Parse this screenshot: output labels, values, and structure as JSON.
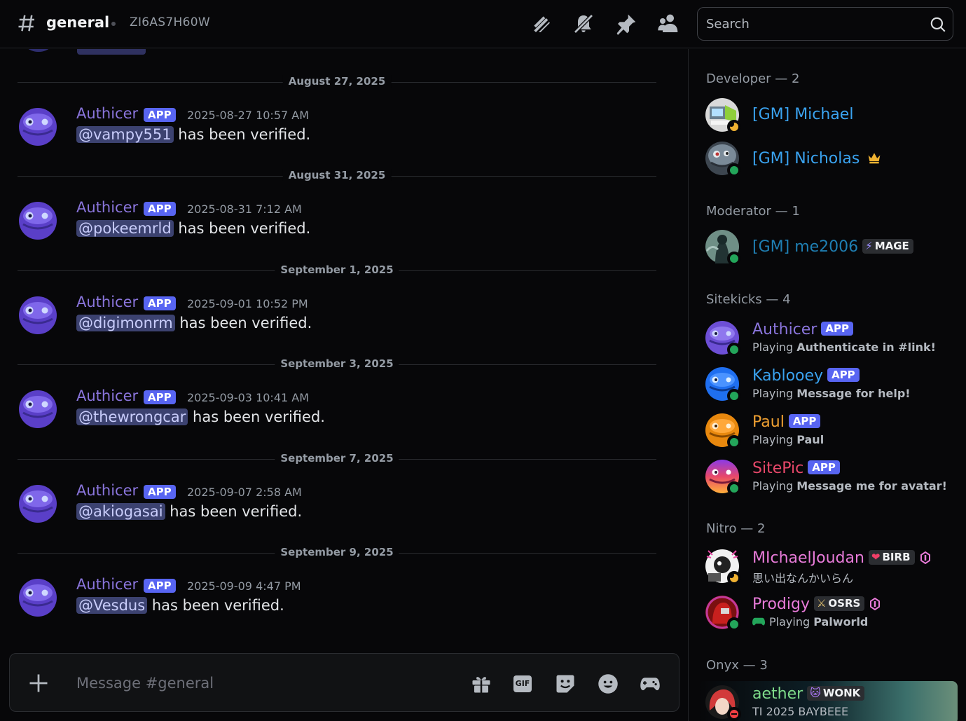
{
  "header": {
    "channel_name": "general",
    "channel_topic": "ZI6AS7H60W",
    "search_placeholder": "Search",
    "icons": [
      "threads-icon",
      "notifications-muted-icon",
      "pin-icon",
      "members-icon"
    ]
  },
  "chat": {
    "messages": [
      {
        "date": "August 27, 2025",
        "author": "Authicer",
        "badge": "APP",
        "time": "2025-08-27 10:57 AM",
        "mention": "@vampy551",
        "text": "has been verified."
      },
      {
        "date": "August 31, 2025",
        "author": "Authicer",
        "badge": "APP",
        "time": "2025-08-31 7:12 AM",
        "mention": "@pokeemrld",
        "text": "has been verified."
      },
      {
        "date": "September 1, 2025",
        "author": "Authicer",
        "badge": "APP",
        "time": "2025-09-01 10:52 PM",
        "mention": "@digimonrm",
        "text": "has been verified."
      },
      {
        "date": "September 3, 2025",
        "author": "Authicer",
        "badge": "APP",
        "time": "2025-09-03 10:41 AM",
        "mention": "@thewrongcar",
        "text": "has been verified."
      },
      {
        "date": "September 7, 2025",
        "author": "Authicer",
        "badge": "APP",
        "time": "2025-09-07 2:58 AM",
        "mention": "@akiogasai",
        "text": "has been verified."
      },
      {
        "date": "September 9, 2025",
        "author": "Authicer",
        "badge": "APP",
        "time": "2025-09-09 4:47 PM",
        "mention": "@Vesdus",
        "text": "has been verified."
      }
    ]
  },
  "composer": {
    "placeholder": "Message #general",
    "gif_label": "GIF"
  },
  "members": {
    "groups": {
      "developer": "Developer — 2",
      "moderator": "Moderator — 1",
      "sitekicks": "Sitekicks — 4",
      "nitro": "Nitro — 2",
      "onyx": "Onyx — 3"
    },
    "michael": {
      "name": "[GM] Michael",
      "color": "#3aa3f0"
    },
    "nicholas": {
      "name": "[GM] Nicholas",
      "color": "#3aa3f0"
    },
    "me2006": {
      "name": "[GM] me2006",
      "tag": "MAGE",
      "color": "#1f7fb3"
    },
    "authicer": {
      "name": "Authicer",
      "badge": "APP",
      "activity_prefix": "Playing",
      "activity": "Authenticate in #link!",
      "color": "#8a75dc"
    },
    "kablooey": {
      "name": "Kablooey",
      "badge": "APP",
      "activity_prefix": "Playing",
      "activity": "Message for help!",
      "color": "#3aa3f0"
    },
    "paul": {
      "name": "Paul",
      "badge": "APP",
      "activity_prefix": "Playing",
      "activity": "Paul",
      "color": "#f0a132"
    },
    "sitepic": {
      "name": "SitePic",
      "badge": "APP",
      "activity_prefix": "Playing",
      "activity": "Message me for avatar!",
      "color": "#e8486a"
    },
    "mjoudan": {
      "name": "MIchaelJoudan",
      "tag": "BIRB",
      "status_text": "思い出なんかいらん",
      "color": "#e87bd9"
    },
    "prodigy": {
      "name": "Prodigy",
      "tag": "OSRS",
      "activity_prefix": "Playing",
      "activity": "Palworld",
      "color": "#e87bd9"
    },
    "aether": {
      "name": "aether",
      "tag": "WONK",
      "status_text": "TI 2025 BAYBEEE",
      "color": "#7fdc8a"
    }
  },
  "colors": {
    "accent": "#5865f2",
    "online": "#23a55a",
    "idle": "#f0b232",
    "dnd": "#f23f43",
    "mention_bg": "#3c4270",
    "nitro_gem": "#e87bd9"
  }
}
